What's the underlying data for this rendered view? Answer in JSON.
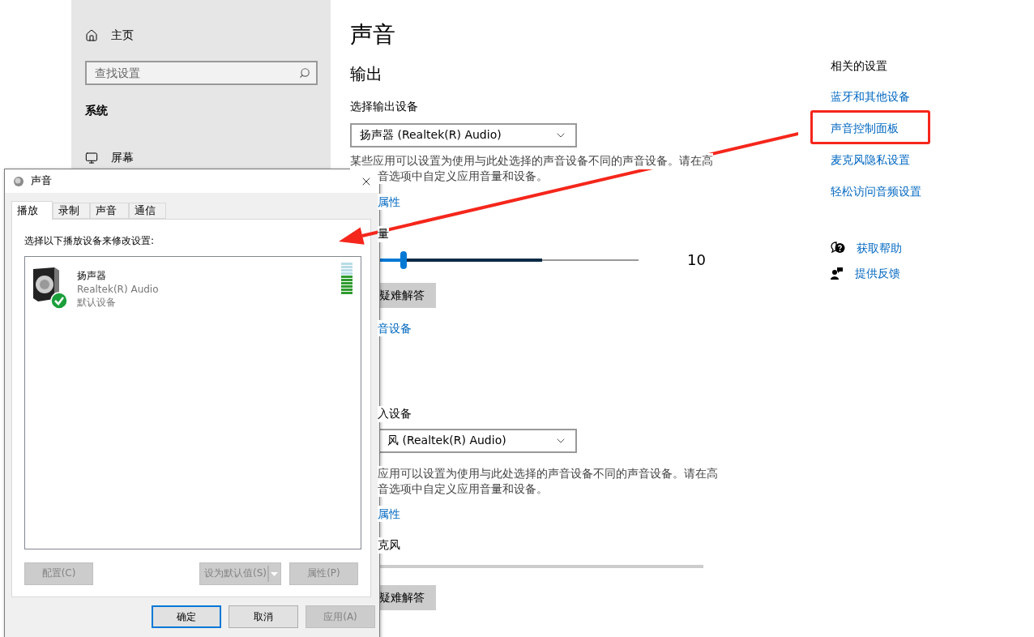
{
  "settings": {
    "sidebar": {
      "home": "主页",
      "search_placeholder": "查找设置",
      "section": "系统",
      "items": [
        {
          "label": "屏幕"
        }
      ]
    },
    "main": {
      "title": "声音",
      "output": {
        "heading": "输出",
        "device_label": "选择输出设备",
        "device": "扬声器 (Realtek(R) Audio)",
        "note": [
          "某些应用可以设置为使用与此处选择的声音设备不同的声音设备。请在高",
          "音选项中自定义应用音量和设备。"
        ],
        "properties_link": "属性",
        "volume_label": "量",
        "volume": {
          "level": 0.1
        },
        "peak_meter": {
          "level": 0.63
        },
        "volume_value": "10",
        "troubleshoot": "疑难解答",
        "manage_link": "音设备"
      },
      "input": {
        "device_label": "入设备",
        "device": "风 (Realtek(R) Audio)",
        "note": [
          "应用可以设置为使用与此处选择的声音设备不同的声音设备。请在高",
          "音选项中自定义应用音量和设备。"
        ],
        "properties_link": "属性",
        "test_label": "克风",
        "mic_meter": {
          "level": 0
        },
        "troubleshoot": "疑难解答"
      }
    },
    "related": {
      "heading": "相关的设置",
      "links": [
        {
          "label": "蓝牙和其他设备",
          "highlighted": false
        },
        {
          "label": "声音控制面板",
          "highlighted": true
        },
        {
          "label": "麦克风隐私设置",
          "highlighted": false
        },
        {
          "label": "轻松访问音频设置",
          "highlighted": false
        }
      ]
    },
    "help": [
      {
        "kind": "help",
        "label": "获取帮助"
      },
      {
        "kind": "feedback",
        "label": "提供反馈"
      }
    ]
  },
  "dialog": {
    "title": "声音",
    "tabs": [
      {
        "label": "播放",
        "selected": true
      },
      {
        "label": "录制",
        "selected": false
      },
      {
        "label": "声音",
        "selected": false
      },
      {
        "label": "通信",
        "selected": false
      }
    ],
    "instruction": "选择以下播放设备来修改设置:",
    "devices": [
      {
        "name": "扬声器",
        "driver": "Realtek(R) Audio",
        "status": "默认设备",
        "default": true,
        "level": 0.6
      }
    ],
    "buttons": [
      {
        "label": "配置(C)",
        "disabled": true,
        "split": false
      },
      {
        "label": "设为默认值(S)",
        "disabled": true,
        "split": true
      },
      {
        "label": "属性(P)",
        "disabled": true,
        "split": false
      }
    ],
    "footer_buttons": [
      {
        "label": "确定",
        "default": true,
        "disabled": false
      },
      {
        "label": "取消",
        "default": false,
        "disabled": false
      },
      {
        "label": "应用(A)",
        "default": false,
        "disabled": true
      }
    ]
  }
}
